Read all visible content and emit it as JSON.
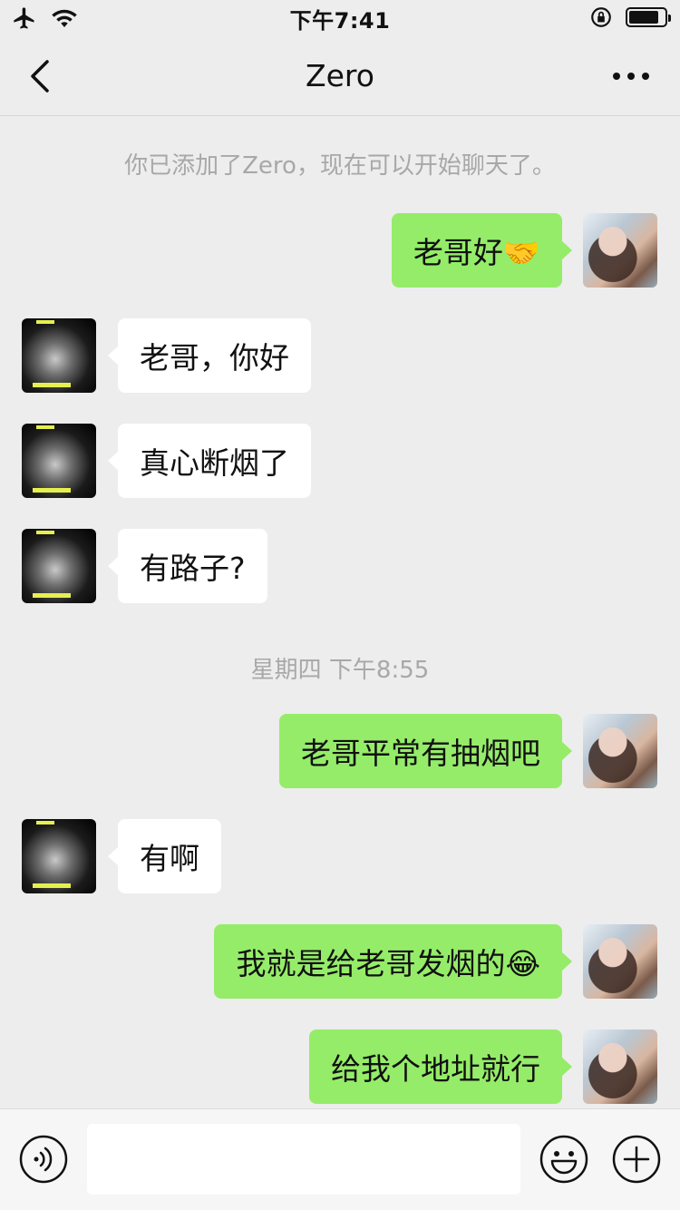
{
  "status_bar": {
    "time": "下午7:41",
    "airplane_icon": "airplane-icon",
    "wifi_icon": "wifi-icon",
    "lock_icon": "orientation-lock-icon",
    "battery_level": 0.85
  },
  "nav": {
    "title": "Zero",
    "back_icon": "chevron-left-icon",
    "more_icon": "more-dots-icon"
  },
  "system_note": "你已添加了Zero，现在可以开始聊天了。",
  "timestamp": "星期四 下午8:55",
  "messages": [
    {
      "from": "me",
      "text": "老哥好🤝"
    },
    {
      "from": "other",
      "text": "老哥，你好"
    },
    {
      "from": "other",
      "text": "真心断烟了"
    },
    {
      "from": "other",
      "text": "有路子?"
    },
    {
      "from": "me",
      "text": "老哥平常有抽烟吧"
    },
    {
      "from": "other",
      "text": "有啊"
    },
    {
      "from": "me",
      "text": "我就是给老哥发烟的😂"
    },
    {
      "from": "me",
      "text": "给我个地址就行"
    }
  ],
  "input_bar": {
    "voice_icon": "voice-icon",
    "emoji_icon": "emoji-icon",
    "plus_icon": "plus-icon",
    "input_value": ""
  },
  "colors": {
    "background": "#ededed",
    "my_bubble": "#95ec69",
    "their_bubble": "#ffffff"
  }
}
